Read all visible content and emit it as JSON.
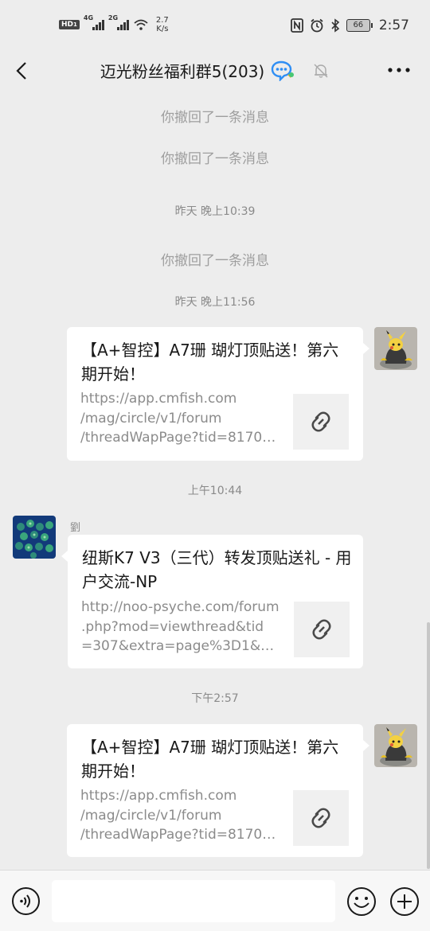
{
  "status_bar": {
    "hd": "HD",
    "hd_sub": "1",
    "sig1_label": "4G",
    "sig2_label": "2G",
    "speed_value": "2.7",
    "speed_unit": "K/s",
    "battery": "66",
    "time": "2:57"
  },
  "nav": {
    "title": "迈光粉丝福利群5(203)"
  },
  "messages": {
    "recall_1": "你撤回了一条消息",
    "recall_2": "你撤回了一条消息",
    "time_1": "昨天 晚上10:39",
    "recall_3": "你撤回了一条消息",
    "time_2": "昨天 晚上11:56",
    "card_1": {
      "title": "【A+智控】A7珊 瑚灯顶贴送！第六期开始！",
      "url_lines": [
        "https://app.cmfish.com",
        "/mag/circle/v1/forum",
        "/threadWapPage?tid=81709..."
      ]
    },
    "time_3": "上午10:44",
    "sender_2": "劉",
    "card_2": {
      "title": "纽斯K7 V3（三代）转发顶贴送礼 - 用户交流-NP",
      "url_lines": [
        "http://noo-psyche.com/forum",
        ".php?mod=viewthread&tid",
        "=307&extra=page%3D1&mo..."
      ]
    },
    "time_4": "下午2:57",
    "card_3": {
      "title": "【A+智控】A7珊 瑚灯顶贴送！第六期开始！",
      "url_lines": [
        "https://app.cmfish.com",
        "/mag/circle/v1/forum",
        "/threadWapPage?tid=81709..."
      ]
    }
  },
  "colors": {
    "background": "#ededed",
    "bubble": "#ffffff",
    "system_text": "#9e9e9e",
    "url_text": "#8b8b8b"
  },
  "icons": [
    "back-arrow-icon",
    "chat-bubble-icon",
    "mute-bell-icon",
    "more-dots-icon",
    "link-icon",
    "voice-icon",
    "emoji-icon",
    "plus-icon"
  ]
}
